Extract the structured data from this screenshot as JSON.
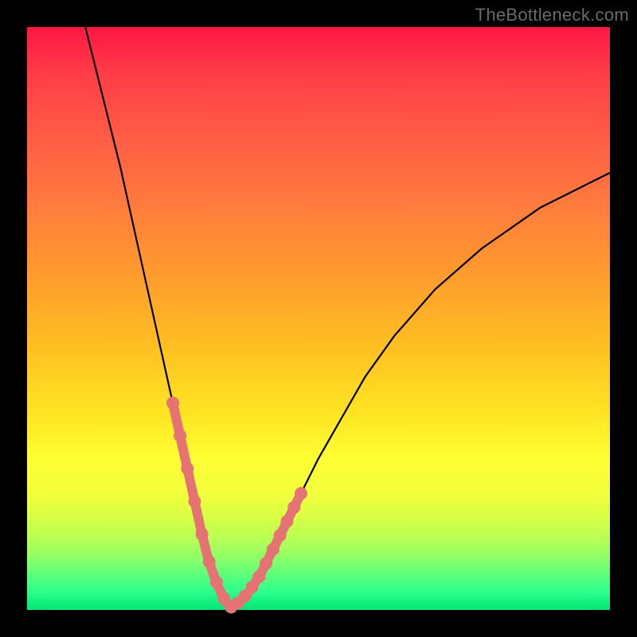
{
  "watermark": "TheBottleneck.com",
  "chart_data": {
    "type": "line",
    "title": "",
    "xlabel": "",
    "ylabel": "",
    "xlim": [
      0,
      100
    ],
    "ylim": [
      0,
      100
    ],
    "series": [
      {
        "name": "curve-left",
        "x": [
          10,
          12,
          14,
          16,
          18,
          20,
          22,
          24,
          26,
          28,
          30,
          31,
          32,
          33,
          34,
          35
        ],
        "y": [
          100,
          92,
          84,
          76,
          67,
          58,
          49,
          40,
          31,
          22,
          13,
          9,
          6,
          3.5,
          1.5,
          0.5
        ]
      },
      {
        "name": "curve-right",
        "x": [
          35,
          36,
          38,
          40,
          42,
          44,
          47,
          50,
          54,
          58,
          63,
          70,
          78,
          88,
          100
        ],
        "y": [
          0.5,
          1,
          3,
          6,
          10,
          14,
          20,
          26,
          33,
          40,
          47,
          55,
          62,
          69,
          75
        ]
      }
    ],
    "highlight_segments": [
      {
        "on": "curve-left",
        "x_from": 25,
        "x_to": 35
      },
      {
        "on": "curve-right",
        "x_from": 35,
        "x_to": 47
      }
    ],
    "colors": {
      "curve": "#000000",
      "highlight": "#e57373"
    }
  }
}
